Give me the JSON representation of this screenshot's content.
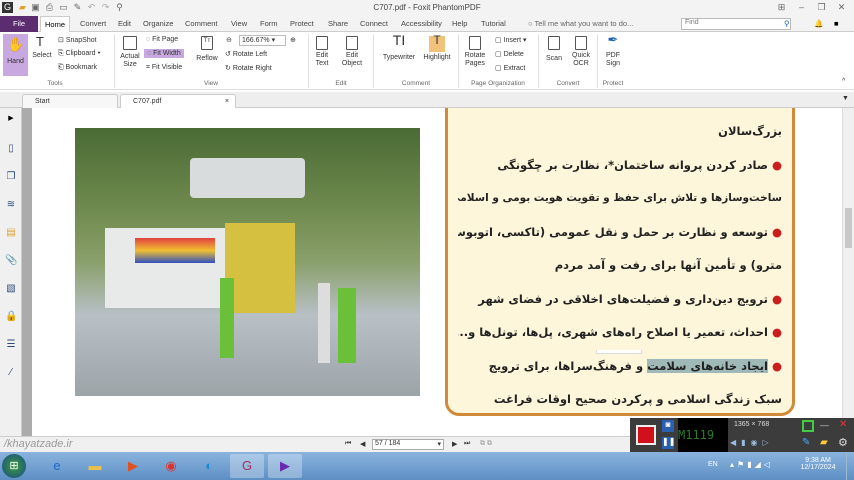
{
  "window": {
    "title": "C707.pdf - Foxit PhantomPDF"
  },
  "menu_tabs": [
    "File",
    "Home",
    "Convert",
    "Edit",
    "Organize",
    "Comment",
    "View",
    "Form",
    "Protect",
    "Share",
    "Connect",
    "Accessibility",
    "Help",
    "Tutorial"
  ],
  "tell_me": "Tell me what you want to do...",
  "find_placeholder": "Find",
  "ribbon": {
    "hand": "Hand",
    "select": "Select",
    "snapshot": "SnapShot",
    "clipboard": "Clipboard",
    "bookmark": "Bookmark",
    "tools_group": "Tools",
    "actual_size": "Actual Size",
    "fit_page": "Fit Page",
    "fit_width": "Fit Width",
    "fit_visible": "Fit Visible",
    "reflow": "Reflow",
    "zoom": "166.67%",
    "rotate_left": "Rotate Left",
    "rotate_right": "Rotate Right",
    "view_group": "View",
    "edit_text": "Edit Text",
    "edit_object": "Edit Object",
    "edit_group": "Edit",
    "typewriter": "Typewriter",
    "highlight": "Highlight",
    "comment_group": "Comment",
    "rotate_pages": "Rotate Pages",
    "insert": "Insert",
    "delete": "Delete",
    "extract": "Extract",
    "page_org_group": "Page Organization",
    "scan": "Scan",
    "quick_ocr": "Quick OCR",
    "convert_group": "Convert",
    "pdf_sign": "PDF Sign",
    "protect_group": "Protect"
  },
  "doc_tabs": [
    "Start",
    "C707.pdf"
  ],
  "content_lines": [
    "بزرگ‌سالان",
    "صادر کردن پروانه ساختمان*، نظارت بر چگونگی",
    "ساخت‌وسازها و تلاش برای حفظ و تقویت هویت بومی و اسلامی در آنها",
    "توسعه و نظارت بر حمل و نقل عمومی (تاکسی، اتوبوس و",
    "مترو) و تأمین آنها برای رفت و آمد مردم",
    "ترویج دین‌داری و فضیلت‌های اخلاقی در فضای شهر",
    "احداث، تعمیر یا اصلاح راه‌های شهری، پل‌ها، تونل‌ها و...",
    "و فرهنگ‌سراها، برای ترویج",
    "سبک زندگی اسلامی و پرکردن صحیح اوقات فراغت"
  ],
  "selected_text": "ایجاد خانه‌های سلامت",
  "page_nav": {
    "value": "57 / 184"
  },
  "watermark": "/khayatzade.ir",
  "recorder": {
    "timer": "M1119",
    "resolution": "1365 × 768"
  },
  "tray": {
    "lang": "EN",
    "time": "9:38 AM",
    "date": "12/17/2024"
  },
  "colors": {
    "accent": "#c7a8e0",
    "file_tab": "#5b2c6f",
    "box_border": "#d08a3a",
    "box_bg": "#fdf6da"
  }
}
